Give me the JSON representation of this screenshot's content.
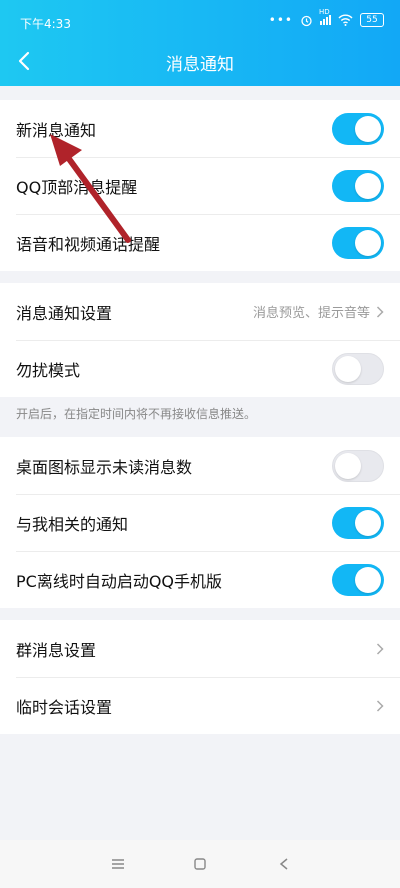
{
  "status_bar": {
    "time": "下午4:33",
    "signal_label": "HD",
    "battery": "55"
  },
  "header": {
    "title": "消息通知"
  },
  "group1": [
    {
      "label": "新消息通知",
      "toggle": "on"
    },
    {
      "label": "QQ顶部消息提醒",
      "toggle": "on"
    },
    {
      "label": "语音和视频通话提醒",
      "toggle": "on"
    }
  ],
  "group2": {
    "settings_label": "消息通知设置",
    "settings_value": "消息预览、提示音等",
    "dnd_label": "勿扰模式",
    "dnd_toggle": "off"
  },
  "dnd_hint": "开启后，在指定时间内将不再接收信息推送。",
  "group3": [
    {
      "label": "桌面图标显示未读消息数",
      "toggle": "off"
    },
    {
      "label": "与我相关的通知",
      "toggle": "on"
    },
    {
      "label": "PC离线时自动启动QQ手机版",
      "toggle": "on"
    }
  ],
  "group4": [
    {
      "label": "群消息设置"
    },
    {
      "label": "临时会话设置"
    }
  ],
  "colors": {
    "accent": "#12b7f5",
    "header_start": "#1ec8f2",
    "header_end": "#12a8f6",
    "annotation_arrow": "#b0232a"
  }
}
